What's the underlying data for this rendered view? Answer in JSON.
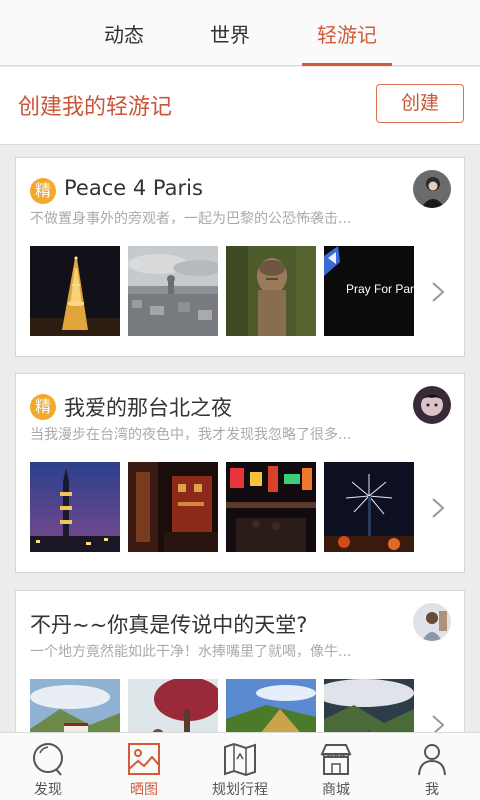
{
  "tabs": [
    {
      "label": "动态",
      "active": false
    },
    {
      "label": "世界",
      "active": false
    },
    {
      "label": "轻游记",
      "active": true
    }
  ],
  "create": {
    "title": "创建我的轻游记",
    "button": "创建"
  },
  "badge": "精",
  "cards": [
    {
      "title": "Peace 4 Paris",
      "subtitle": "不做置身事外的旁观者，一起为巴黎的公恐怖袭击...",
      "featured": true,
      "photos": [
        "eiffel-tower-night",
        "paris-city-skyline",
        "giant-buddha-statue",
        "pray-for-paris"
      ],
      "photo_caption": "Pray For Paris"
    },
    {
      "title": "我爱的那台北之夜",
      "subtitle": "当我漫步在台湾的夜色中，我才发现我忽略了很多...",
      "featured": true,
      "photos": [
        "taipei-101-dusk",
        "temple-lanterns",
        "night-market-street",
        "taipei-fireworks"
      ]
    },
    {
      "title": "不丹~~你真是传说中的天堂?",
      "subtitle": "一个地方竟然能如此干净！水捧嘴里了就喝，像牛...",
      "featured": false,
      "photos": [
        "bhutan-valley-dzong",
        "red-tree-couple",
        "hay-hill-meadow",
        "mountain-valley-clouds"
      ]
    }
  ],
  "nav": [
    {
      "label": "发现",
      "icon": "discover-icon",
      "active": false
    },
    {
      "label": "晒图",
      "icon": "photo-icon",
      "active": true
    },
    {
      "label": "规划行程",
      "icon": "map-icon",
      "active": false
    },
    {
      "label": "商城",
      "icon": "shop-icon",
      "active": false
    },
    {
      "label": "我",
      "icon": "person-icon",
      "active": false
    }
  ],
  "colors": {
    "accent": "#d35b3a",
    "badge": "#f2a829"
  }
}
